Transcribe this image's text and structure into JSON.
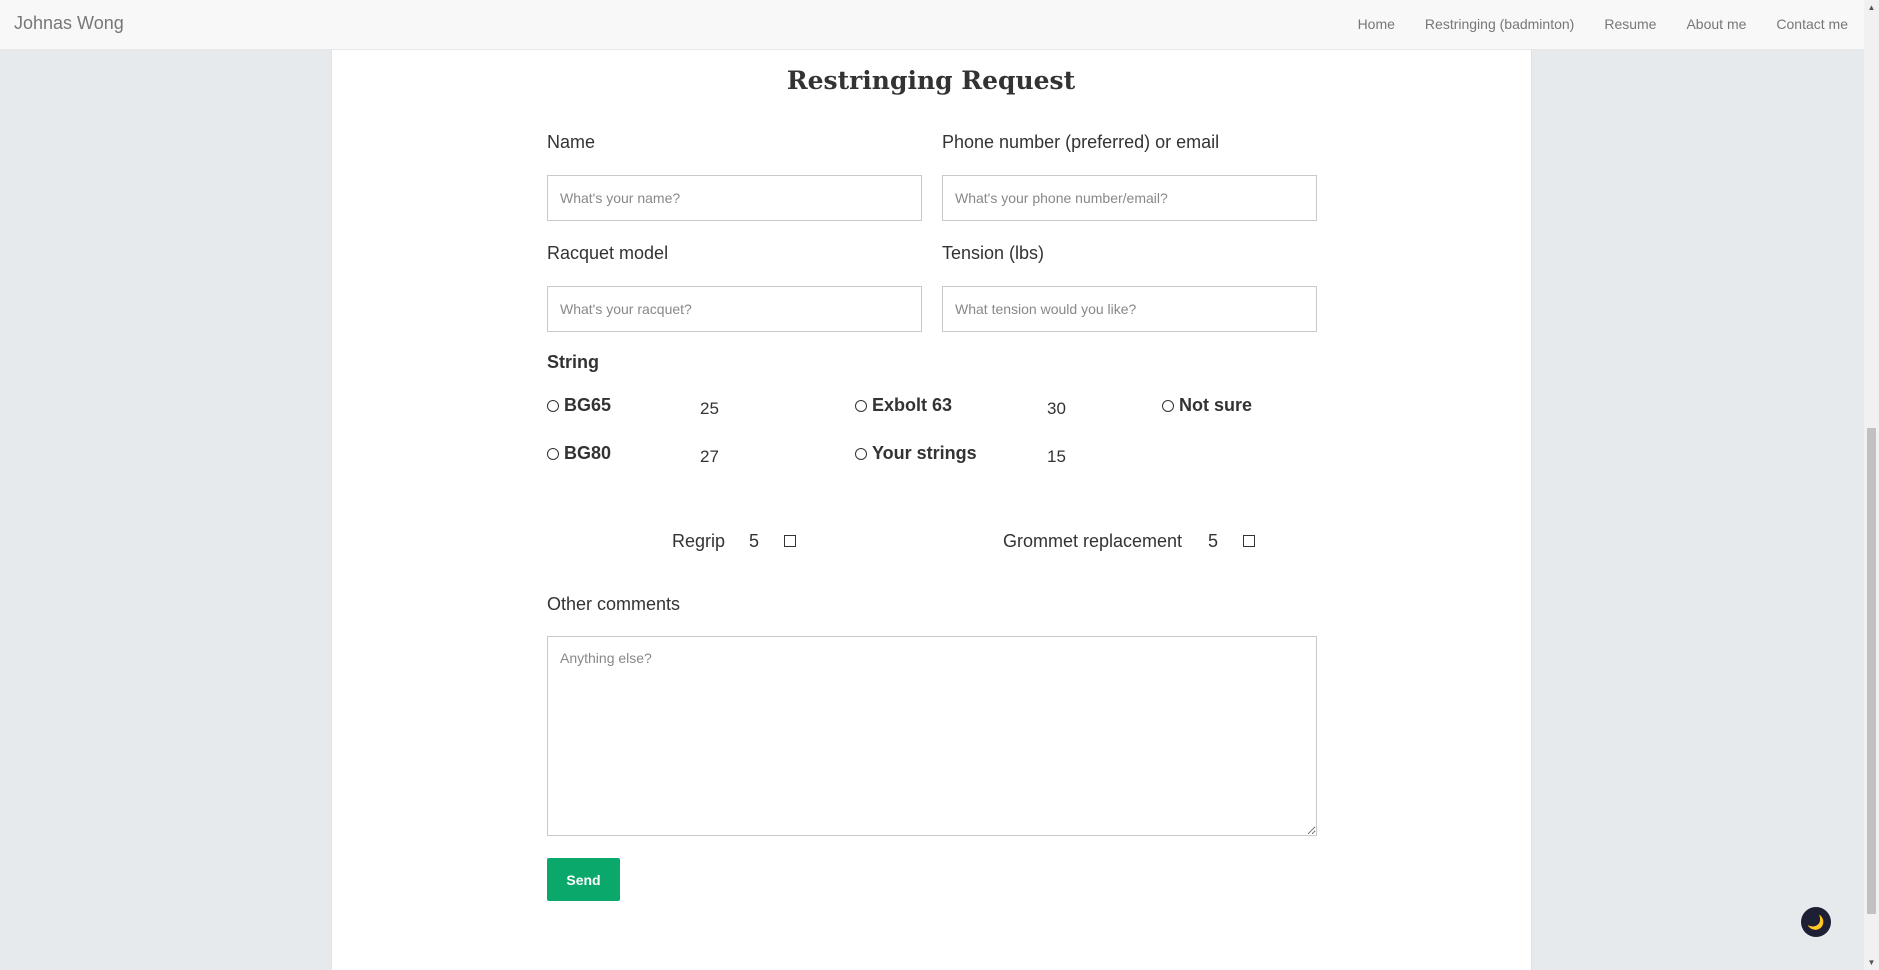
{
  "nav": {
    "brand": "Johnas Wong",
    "links": [
      "Home",
      "Restringing (badminton)",
      "Resume",
      "About me",
      "Contact me"
    ]
  },
  "form": {
    "title": "Restringing Request",
    "name_label": "Name",
    "name_placeholder": "What's your name?",
    "contact_label": "Phone number (preferred) or email",
    "contact_placeholder": "What's your phone number/email?",
    "racquet_label": "Racquet model",
    "racquet_placeholder": "What's your racquet?",
    "tension_label": "Tension (lbs)",
    "tension_placeholder": "What tension would you like?",
    "string_heading": "String",
    "strings": [
      {
        "label": "BG65",
        "price": "25"
      },
      {
        "label": "Exbolt 63",
        "price": "30"
      },
      {
        "label": "Not sure",
        "price": ""
      },
      {
        "label": "BG80",
        "price": "27"
      },
      {
        "label": "Your strings",
        "price": "15"
      }
    ],
    "addons": [
      {
        "label": "Regrip",
        "price": "5"
      },
      {
        "label": "Grommet replacement",
        "price": "5"
      }
    ],
    "comments_label": "Other comments",
    "comments_placeholder": "Anything else?",
    "send_label": "Send"
  },
  "scrollbar": {
    "up_glyph": "▲",
    "down_glyph": "▼"
  },
  "theme_toggle": {
    "glyph": "🌙"
  }
}
